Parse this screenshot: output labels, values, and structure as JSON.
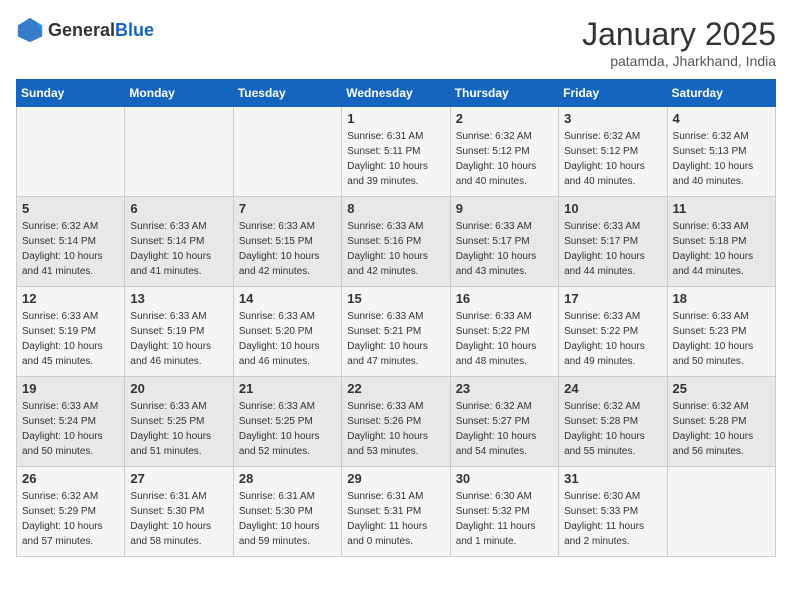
{
  "logo": {
    "text_general": "General",
    "text_blue": "Blue"
  },
  "calendar": {
    "title": "January 2025",
    "subtitle": "patamda, Jharkhand, India"
  },
  "weekdays": [
    "Sunday",
    "Monday",
    "Tuesday",
    "Wednesday",
    "Thursday",
    "Friday",
    "Saturday"
  ],
  "weeks": [
    [
      {
        "day": "",
        "sunrise": "",
        "sunset": "",
        "daylight": ""
      },
      {
        "day": "",
        "sunrise": "",
        "sunset": "",
        "daylight": ""
      },
      {
        "day": "",
        "sunrise": "",
        "sunset": "",
        "daylight": ""
      },
      {
        "day": "1",
        "sunrise": "Sunrise: 6:31 AM",
        "sunset": "Sunset: 5:11 PM",
        "daylight": "Daylight: 10 hours and 39 minutes."
      },
      {
        "day": "2",
        "sunrise": "Sunrise: 6:32 AM",
        "sunset": "Sunset: 5:12 PM",
        "daylight": "Daylight: 10 hours and 40 minutes."
      },
      {
        "day": "3",
        "sunrise": "Sunrise: 6:32 AM",
        "sunset": "Sunset: 5:12 PM",
        "daylight": "Daylight: 10 hours and 40 minutes."
      },
      {
        "day": "4",
        "sunrise": "Sunrise: 6:32 AM",
        "sunset": "Sunset: 5:13 PM",
        "daylight": "Daylight: 10 hours and 40 minutes."
      }
    ],
    [
      {
        "day": "5",
        "sunrise": "Sunrise: 6:32 AM",
        "sunset": "Sunset: 5:14 PM",
        "daylight": "Daylight: 10 hours and 41 minutes."
      },
      {
        "day": "6",
        "sunrise": "Sunrise: 6:33 AM",
        "sunset": "Sunset: 5:14 PM",
        "daylight": "Daylight: 10 hours and 41 minutes."
      },
      {
        "day": "7",
        "sunrise": "Sunrise: 6:33 AM",
        "sunset": "Sunset: 5:15 PM",
        "daylight": "Daylight: 10 hours and 42 minutes."
      },
      {
        "day": "8",
        "sunrise": "Sunrise: 6:33 AM",
        "sunset": "Sunset: 5:16 PM",
        "daylight": "Daylight: 10 hours and 42 minutes."
      },
      {
        "day": "9",
        "sunrise": "Sunrise: 6:33 AM",
        "sunset": "Sunset: 5:17 PM",
        "daylight": "Daylight: 10 hours and 43 minutes."
      },
      {
        "day": "10",
        "sunrise": "Sunrise: 6:33 AM",
        "sunset": "Sunset: 5:17 PM",
        "daylight": "Daylight: 10 hours and 44 minutes."
      },
      {
        "day": "11",
        "sunrise": "Sunrise: 6:33 AM",
        "sunset": "Sunset: 5:18 PM",
        "daylight": "Daylight: 10 hours and 44 minutes."
      }
    ],
    [
      {
        "day": "12",
        "sunrise": "Sunrise: 6:33 AM",
        "sunset": "Sunset: 5:19 PM",
        "daylight": "Daylight: 10 hours and 45 minutes."
      },
      {
        "day": "13",
        "sunrise": "Sunrise: 6:33 AM",
        "sunset": "Sunset: 5:19 PM",
        "daylight": "Daylight: 10 hours and 46 minutes."
      },
      {
        "day": "14",
        "sunrise": "Sunrise: 6:33 AM",
        "sunset": "Sunset: 5:20 PM",
        "daylight": "Daylight: 10 hours and 46 minutes."
      },
      {
        "day": "15",
        "sunrise": "Sunrise: 6:33 AM",
        "sunset": "Sunset: 5:21 PM",
        "daylight": "Daylight: 10 hours and 47 minutes."
      },
      {
        "day": "16",
        "sunrise": "Sunrise: 6:33 AM",
        "sunset": "Sunset: 5:22 PM",
        "daylight": "Daylight: 10 hours and 48 minutes."
      },
      {
        "day": "17",
        "sunrise": "Sunrise: 6:33 AM",
        "sunset": "Sunset: 5:22 PM",
        "daylight": "Daylight: 10 hours and 49 minutes."
      },
      {
        "day": "18",
        "sunrise": "Sunrise: 6:33 AM",
        "sunset": "Sunset: 5:23 PM",
        "daylight": "Daylight: 10 hours and 50 minutes."
      }
    ],
    [
      {
        "day": "19",
        "sunrise": "Sunrise: 6:33 AM",
        "sunset": "Sunset: 5:24 PM",
        "daylight": "Daylight: 10 hours and 50 minutes."
      },
      {
        "day": "20",
        "sunrise": "Sunrise: 6:33 AM",
        "sunset": "Sunset: 5:25 PM",
        "daylight": "Daylight: 10 hours and 51 minutes."
      },
      {
        "day": "21",
        "sunrise": "Sunrise: 6:33 AM",
        "sunset": "Sunset: 5:25 PM",
        "daylight": "Daylight: 10 hours and 52 minutes."
      },
      {
        "day": "22",
        "sunrise": "Sunrise: 6:33 AM",
        "sunset": "Sunset: 5:26 PM",
        "daylight": "Daylight: 10 hours and 53 minutes."
      },
      {
        "day": "23",
        "sunrise": "Sunrise: 6:32 AM",
        "sunset": "Sunset: 5:27 PM",
        "daylight": "Daylight: 10 hours and 54 minutes."
      },
      {
        "day": "24",
        "sunrise": "Sunrise: 6:32 AM",
        "sunset": "Sunset: 5:28 PM",
        "daylight": "Daylight: 10 hours and 55 minutes."
      },
      {
        "day": "25",
        "sunrise": "Sunrise: 6:32 AM",
        "sunset": "Sunset: 5:28 PM",
        "daylight": "Daylight: 10 hours and 56 minutes."
      }
    ],
    [
      {
        "day": "26",
        "sunrise": "Sunrise: 6:32 AM",
        "sunset": "Sunset: 5:29 PM",
        "daylight": "Daylight: 10 hours and 57 minutes."
      },
      {
        "day": "27",
        "sunrise": "Sunrise: 6:31 AM",
        "sunset": "Sunset: 5:30 PM",
        "daylight": "Daylight: 10 hours and 58 minutes."
      },
      {
        "day": "28",
        "sunrise": "Sunrise: 6:31 AM",
        "sunset": "Sunset: 5:30 PM",
        "daylight": "Daylight: 10 hours and 59 minutes."
      },
      {
        "day": "29",
        "sunrise": "Sunrise: 6:31 AM",
        "sunset": "Sunset: 5:31 PM",
        "daylight": "Daylight: 11 hours and 0 minutes."
      },
      {
        "day": "30",
        "sunrise": "Sunrise: 6:30 AM",
        "sunset": "Sunset: 5:32 PM",
        "daylight": "Daylight: 11 hours and 1 minute."
      },
      {
        "day": "31",
        "sunrise": "Sunrise: 6:30 AM",
        "sunset": "Sunset: 5:33 PM",
        "daylight": "Daylight: 11 hours and 2 minutes."
      },
      {
        "day": "",
        "sunrise": "",
        "sunset": "",
        "daylight": ""
      }
    ]
  ]
}
